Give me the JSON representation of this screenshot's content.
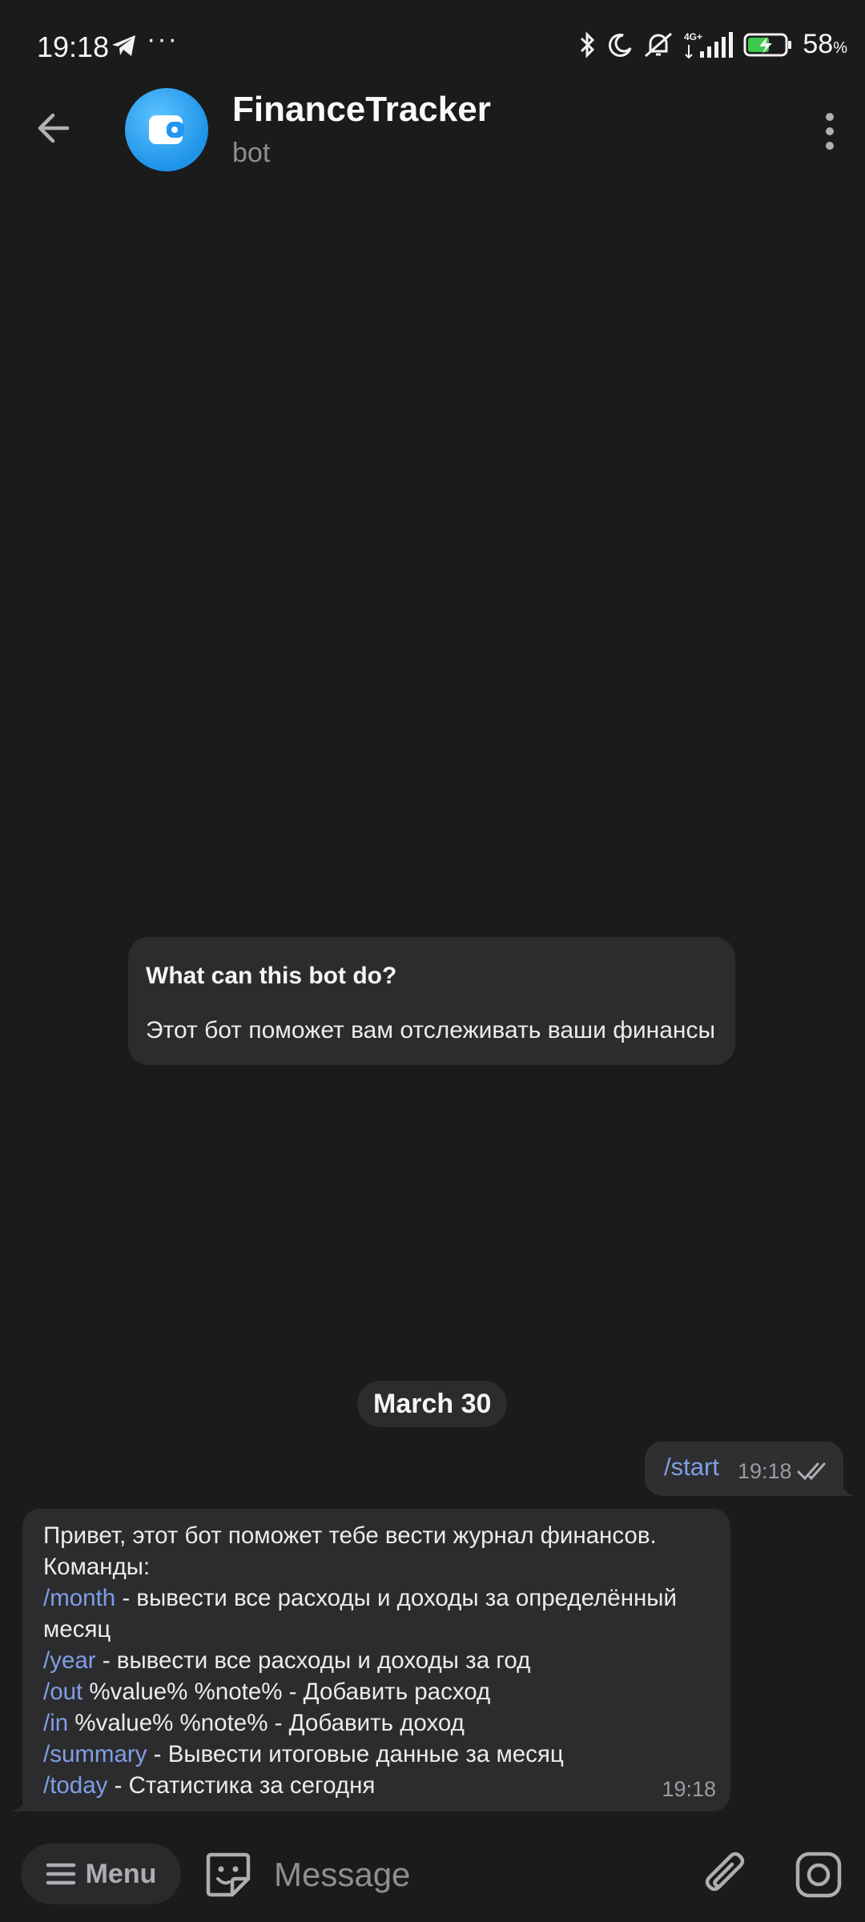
{
  "status_bar": {
    "time": "19:18",
    "dots": "···",
    "battery_percent": "58",
    "battery_unit": "%",
    "icons": [
      "telegram-icon",
      "bluetooth-icon",
      "moon-icon",
      "silent-bell-icon",
      "signal-4g-icon",
      "battery-charging-icon"
    ]
  },
  "header": {
    "title": "FinanceTracker",
    "subtitle": "bot",
    "avatar_color": "#2196f3"
  },
  "info_card": {
    "title": "What can this bot do?",
    "text": "Этот бот поможет вам отслеживать ваши финансы"
  },
  "date_separator": "March 30",
  "outgoing_message": {
    "text": "/start",
    "time": "19:18",
    "status": "read"
  },
  "incoming_message": {
    "line1": "Привет, этот бот поможет тебе вести журнал финансов.",
    "line2": "Команды:",
    "commands": [
      {
        "cmd": "/month",
        "desc_a": " - вывести все расходы и доходы за определённый",
        "desc_b": "месяц"
      },
      {
        "cmd": "/year",
        "desc": " - вывести все расходы и доходы за год"
      },
      {
        "cmd": "/out",
        "desc": " %value% %note% - Добавить расход"
      },
      {
        "cmd": "/in",
        "desc": " %value% %note% - Добавить доход"
      },
      {
        "cmd": "/summary",
        "desc": " - Вывести итоговые данные за месяц"
      },
      {
        "cmd": "/today",
        "desc": " - Статистика за сегодня"
      }
    ],
    "time": "19:18"
  },
  "bottom_bar": {
    "menu_label": "Menu",
    "message_placeholder": "Message"
  },
  "colors": {
    "background": "#1b1b1c",
    "bubble": "#2c2c2e",
    "link": "#7f9fe6",
    "muted": "#9b9ba0"
  }
}
